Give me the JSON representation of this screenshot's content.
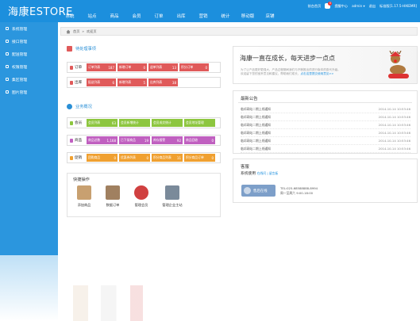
{
  "header": {
    "logo": "海康ESTORE",
    "nav": [
      "系统",
      "站点",
      "商品",
      "会员",
      "订单",
      "出库",
      "营销",
      "统计",
      "移动版",
      "店铺"
    ],
    "links": {
      "home": "前台首页",
      "notif_badge": "0",
      "notif": "提醒中心",
      "user": "admin ▾",
      "exit": "退出",
      "version": "标准版[1.17.5-HIKEMR]"
    }
  },
  "sidebar": {
    "items": [
      "系统管理",
      "接口管理",
      "配送管理",
      "权限管理",
      "集区管理",
      "图片管理"
    ]
  },
  "breadcrumb": {
    "home": "首页",
    "sep": "»",
    "current": "欢迎页"
  },
  "todo": {
    "title": "待处理事项",
    "rows": [
      {
        "label": "订单",
        "color": "#e05a5a",
        "cells": [
          {
            "t": "订单列表",
            "v": "187"
          },
          {
            "t": "新增订单",
            "v": "0"
          },
          {
            "t": "退单列表",
            "v": "13"
          },
          {
            "t": "积分订单",
            "v": "0"
          }
        ]
      },
      {
        "label": "出库",
        "color": "#e05a5a",
        "cells": [
          {
            "t": "配送列表",
            "v": "6"
          },
          {
            "t": "新增列表",
            "v": "5"
          },
          {
            "t": "出库列表",
            "v": "38"
          }
        ]
      }
    ]
  },
  "overview": {
    "title": "业务概况",
    "rows": [
      {
        "label": "会员",
        "lc": "#8dc63f",
        "cells": [
          {
            "t": "会员列表",
            "v": "63",
            "c": "#8dc63f"
          },
          {
            "t": "会员新增统计",
            "v": "",
            "c": "#8dc63f"
          },
          {
            "t": "会员成交统计",
            "v": "",
            "c": "#8dc63f"
          },
          {
            "t": "会员地址管理",
            "v": "",
            "c": "#8dc63f"
          }
        ]
      },
      {
        "label": "商品",
        "lc": "#c060c0",
        "cells": [
          {
            "t": "商品总数",
            "v": "1,168",
            "c": "#c060c0"
          },
          {
            "t": "已下架商品",
            "v": "19",
            "c": "#c060c0"
          },
          {
            "t": "库存报警",
            "v": "92",
            "c": "#c060c0"
          },
          {
            "t": "商品回收",
            "v": "0",
            "c": "#c060c0"
          }
        ]
      },
      {
        "label": "促销",
        "lc": "#f0a030",
        "cells": [
          {
            "t": "团购商品",
            "v": "0",
            "c": "#f0a030"
          },
          {
            "t": "优惠券列表",
            "v": "0",
            "c": "#f0a030"
          },
          {
            "t": "积分商品列表",
            "v": "11",
            "c": "#f0a030"
          },
          {
            "t": "积分商品订单",
            "v": "0",
            "c": "#f0a030"
          }
        ]
      }
    ]
  },
  "quick": {
    "title": "快捷操作",
    "items": [
      "添加商品",
      "数据订单",
      "管理会员",
      "管理企业主站"
    ]
  },
  "welcome": {
    "headline": "海康一直在成长，每天进步一点点",
    "text1": "为了让产品更好更强大，产品过程期间我们与不断推出的进行版本的迭代升级。",
    "text2": "欢迎留下您的宝贵意见和建议，帮助我们成长，",
    "link": "点击这里提交使用意见>>"
  },
  "notice": {
    "title": "最新公告",
    "rows": [
      {
        "text": "临邛网站二期上线通知",
        "date": "2014-10-14 10:53:46"
      },
      {
        "text": "临邛网站二期上线通知",
        "date": "2014-10-14 10:53:46"
      },
      {
        "text": "临邛网站二期上线通知",
        "date": "2014-10-14 10:53:46"
      },
      {
        "text": "临邛网站二期上线通知",
        "date": "2014-10-14 10:53:46"
      },
      {
        "text": "临邛网站二期上线通知",
        "date": "2014-10-14 10:53:46"
      },
      {
        "text": "临邛网站二期上线通知",
        "date": "2014-10-14 10:53:46"
      }
    ]
  },
  "service": {
    "title": "客服",
    "sub": "系统使用",
    "links": "在线问 | 留言板",
    "online": "售后在线",
    "tel": "TEL:025-68588888-8994",
    "hours": "周一至周六 9:00-18:00"
  }
}
